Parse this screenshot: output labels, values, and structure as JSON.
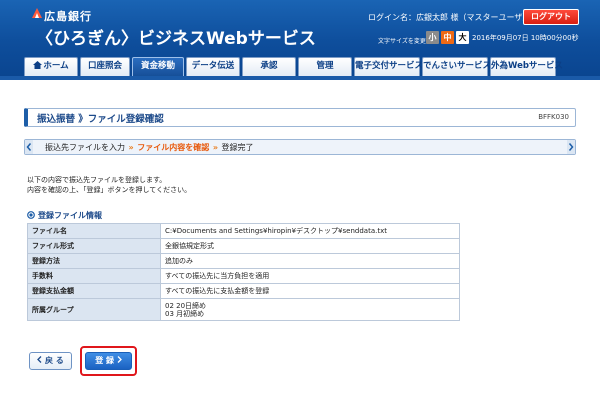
{
  "header": {
    "bank_name": "広島銀行",
    "service_name": "〈ひろぎん〉ビジネスWebサービス",
    "login_info": "ログイン名：広銀太郎 様（マスターユーザ）",
    "logout_label": "ログアウト",
    "font_size_label": "文字サイズを変更",
    "font_small": "小",
    "font_medium": "中",
    "font_large": "大",
    "datetime": "2016年09月07日 10時00分00秒"
  },
  "nav": {
    "tabs": [
      {
        "label": "ホーム"
      },
      {
        "label": "口座照会"
      },
      {
        "label": "資金移動"
      },
      {
        "label": "データ伝送"
      },
      {
        "label": "承認"
      },
      {
        "label": "管理"
      },
      {
        "label": "電子交付サービス"
      },
      {
        "label": "でんさいサービス"
      },
      {
        "label": "外為Webサービス"
      }
    ],
    "active_index": 2
  },
  "page": {
    "title": "振込振替 》ファイル登録確認",
    "screen_id": "BFFK030"
  },
  "steps": {
    "step1": "振込先ファイルを入力",
    "step2": "ファイル内容を確認",
    "step3": "登録完了",
    "separator": "»"
  },
  "instructions": {
    "line1": "以下の内容で振込先ファイルを登録します。",
    "line2": "内容を確認の上、「登録」ボタンを押してください。"
  },
  "section": {
    "title": "登録ファイル情報"
  },
  "file_info": {
    "rows": [
      {
        "label": "ファイル名",
        "value": "C:¥Documents and Settings¥hiropin¥デスクトップ¥senddata.txt"
      },
      {
        "label": "ファイル形式",
        "value": "全銀協規定形式"
      },
      {
        "label": "登録方法",
        "value": "追加のみ"
      },
      {
        "label": "手数料",
        "value": "すべての振込先に当方負担を適用"
      },
      {
        "label": "登録支払金額",
        "value": "すべての振込先に支払金額を登録"
      },
      {
        "label": "所属グループ",
        "value": "02 20日締め",
        "value2": "03 月初締め"
      }
    ]
  },
  "buttons": {
    "back_label": "戻 る",
    "register_label": "登 録"
  },
  "colors": {
    "header_blue": "#0e4e9c",
    "accent_orange": "#e8590c",
    "logout_red": "#d81e10",
    "highlight_red": "#e0161b"
  }
}
